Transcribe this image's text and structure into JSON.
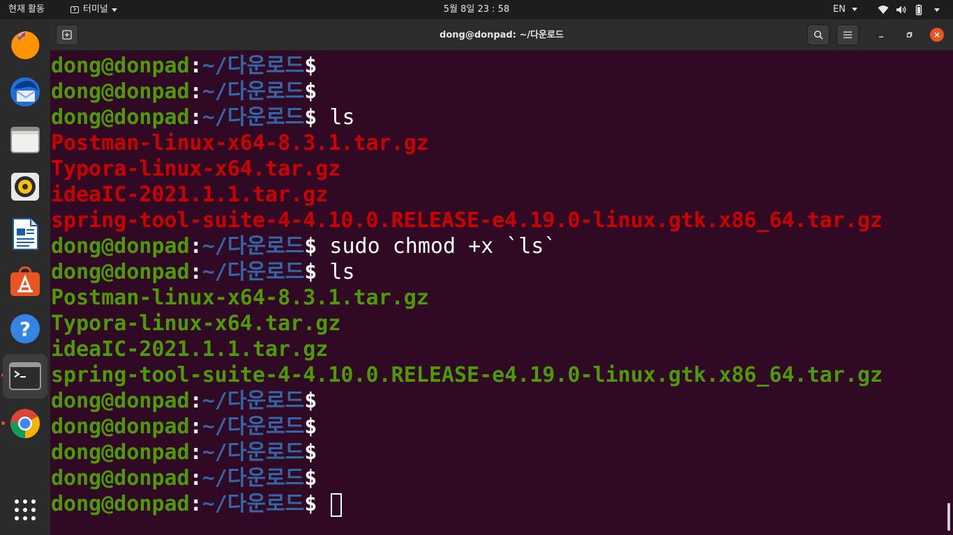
{
  "topbar": {
    "activities": "현재 활동",
    "app_menu": "터미널",
    "clock": "5월 8일  23 : 58",
    "language": "EN"
  },
  "dock": {
    "items": [
      {
        "name": "firefox"
      },
      {
        "name": "thunderbird"
      },
      {
        "name": "files"
      },
      {
        "name": "rhythmbox"
      },
      {
        "name": "libreoffice-writer"
      },
      {
        "name": "ubuntu-software"
      },
      {
        "name": "help"
      },
      {
        "name": "terminal"
      },
      {
        "name": "chrome"
      },
      {
        "name": "show-applications"
      }
    ]
  },
  "window": {
    "title": "dong@donpad: ~/다운로드"
  },
  "terminal": {
    "prompt": {
      "user": "dong@donpad",
      "colon": ":",
      "path": "~/다운로드",
      "dollar": "$"
    },
    "lines": [
      {
        "type": "prompt",
        "cmd": ""
      },
      {
        "type": "prompt",
        "cmd": ""
      },
      {
        "type": "prompt",
        "cmd": " ls"
      },
      {
        "type": "output",
        "color": "red",
        "text": "Postman-linux-x64-8.3.1.tar.gz"
      },
      {
        "type": "output",
        "color": "red",
        "text": "Typora-linux-x64.tar.gz"
      },
      {
        "type": "output",
        "color": "red",
        "text": "ideaIC-2021.1.1.tar.gz"
      },
      {
        "type": "output",
        "color": "red",
        "text": "spring-tool-suite-4-4.10.0.RELEASE-e4.19.0-linux.gtk.x86_64.tar.gz"
      },
      {
        "type": "prompt",
        "cmd": " sudo chmod +x `ls`"
      },
      {
        "type": "prompt",
        "cmd": " ls"
      },
      {
        "type": "output",
        "color": "green",
        "text": "Postman-linux-x64-8.3.1.tar.gz"
      },
      {
        "type": "output",
        "color": "green",
        "text": "Typora-linux-x64.tar.gz"
      },
      {
        "type": "output",
        "color": "green",
        "text": "ideaIC-2021.1.1.tar.gz"
      },
      {
        "type": "output",
        "color": "green",
        "text": "spring-tool-suite-4-4.10.0.RELEASE-e4.19.0-linux.gtk.x86_64.tar.gz"
      },
      {
        "type": "prompt",
        "cmd": ""
      },
      {
        "type": "prompt",
        "cmd": ""
      },
      {
        "type": "prompt",
        "cmd": ""
      },
      {
        "type": "prompt",
        "cmd": ""
      },
      {
        "type": "prompt",
        "cmd": " ",
        "cursor": true
      }
    ]
  }
}
